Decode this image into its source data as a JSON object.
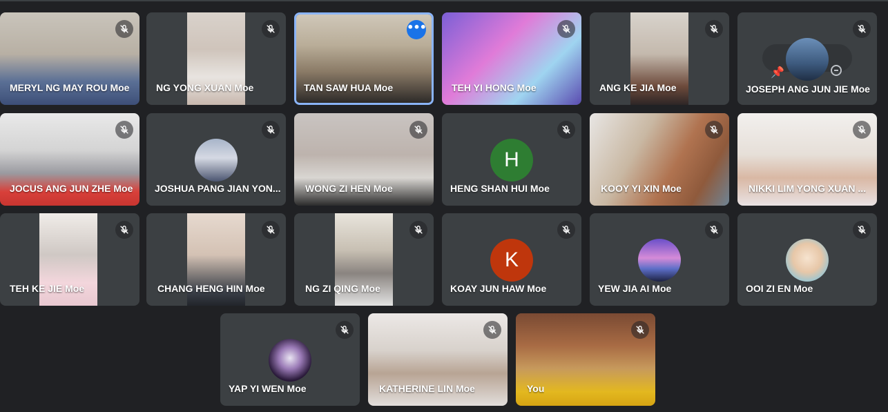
{
  "meeting": {
    "mic_icon": "mic-off-icon",
    "more_icon": "more-options-icon",
    "more_label": "•••",
    "participants": [
      {
        "name": "MERYL NG MAY ROU Moe"
      },
      {
        "name": "NG YONG XUAN Moe"
      },
      {
        "name": "TAN SAW HUA Moe",
        "speaking": true
      },
      {
        "name": "TEH YI HONG Moe"
      },
      {
        "name": "ANG KE JIA Moe"
      },
      {
        "name": "JOSEPH ANG JUN JIE Moe"
      },
      {
        "name": "JOCUS ANG JUN ZHE Moe"
      },
      {
        "name": "JOSHUA PANG JIAN YON..."
      },
      {
        "name": "WONG ZI HEN Moe"
      },
      {
        "name": "HENG SHAN HUI Moe",
        "avatar_letter": "H",
        "avatar_color": "#2e7d32"
      },
      {
        "name": "KOOY YI XIN Moe"
      },
      {
        "name": "NIKKI LIM YONG XUAN ..."
      },
      {
        "name": "TEH KE JIE Moe"
      },
      {
        "name": "CHANG HENG HIN Moe"
      },
      {
        "name": "NG ZI QING Moe"
      },
      {
        "name": "KOAY JUN HAW Moe",
        "avatar_letter": "K",
        "avatar_color": "#bf360c"
      },
      {
        "name": "YEW JIA AI Moe"
      },
      {
        "name": "OOI ZI EN Moe"
      },
      {
        "name": "YAP YI WEN Moe"
      },
      {
        "name": "KATHERINE LIN Moe"
      },
      {
        "name": "You"
      }
    ]
  }
}
